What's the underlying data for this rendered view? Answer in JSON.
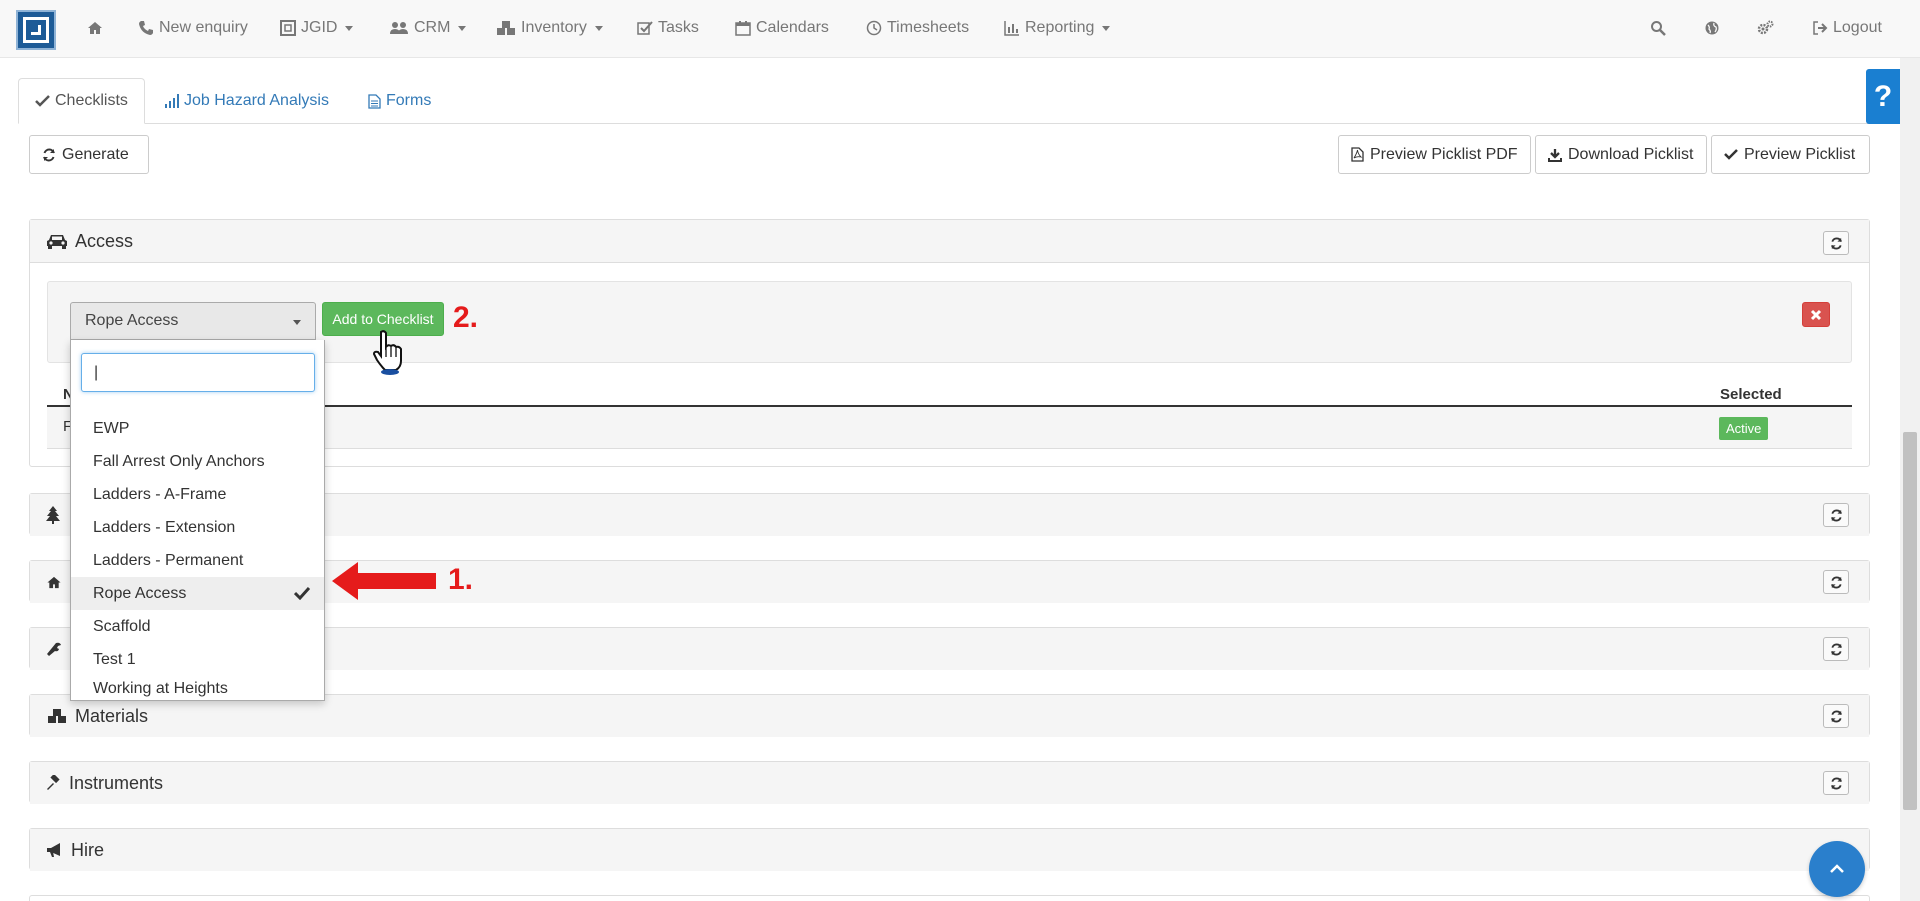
{
  "navbar": {
    "items": [
      {
        "icon": "home-icon",
        "label": ""
      },
      {
        "icon": "phone-icon",
        "label": "New enquiry"
      },
      {
        "icon": "jgid-icon",
        "label": "JGID"
      },
      {
        "icon": "users-icon",
        "label": "CRM"
      },
      {
        "icon": "cubes-icon",
        "label": "Inventory"
      },
      {
        "icon": "check-icon",
        "label": "Tasks"
      },
      {
        "icon": "calendar-icon",
        "label": "Calendars"
      },
      {
        "icon": "clock-icon",
        "label": "Timesheets"
      },
      {
        "icon": "bar-chart-icon",
        "label": "Reporting"
      }
    ],
    "logout": "Logout"
  },
  "tabs": [
    {
      "icon": "check-icon",
      "label": "Checklists"
    },
    {
      "icon": "signal-icon",
      "label": "Job Hazard Analysis"
    },
    {
      "icon": "file-icon",
      "label": "Forms"
    }
  ],
  "toolbar": {
    "generate": "Generate",
    "preview_pdf": "Preview Picklist PDF",
    "download": "Download Picklist",
    "preview": "Preview Picklist"
  },
  "panels": {
    "access": "Access",
    "materials": "Materials",
    "instruments": "Instruments",
    "hire": "Hire"
  },
  "access": {
    "selected_value": "Rope Access",
    "add_button": "Add to Checklist",
    "table_header_selected": "Selected",
    "row_status": "Active",
    "row_initial": "F",
    "header_initial": "N"
  },
  "dropdown": {
    "search_value": "",
    "options": [
      "EWP",
      "Fall Arrest Only Anchors",
      "Ladders - A-Frame",
      "Ladders - Extension",
      "Ladders - Permanent",
      "Rope Access",
      "Scaffold",
      "Test 1",
      "Working at Heights"
    ],
    "selected_index": 5
  },
  "annotations": {
    "step1": "1.",
    "step2": "2."
  },
  "help": "?",
  "colors": {
    "accent": "#337ab7",
    "success": "#5cb85c",
    "danger": "#d9534f",
    "annotation": "#e51b1b",
    "logo": "#1d5b97"
  }
}
